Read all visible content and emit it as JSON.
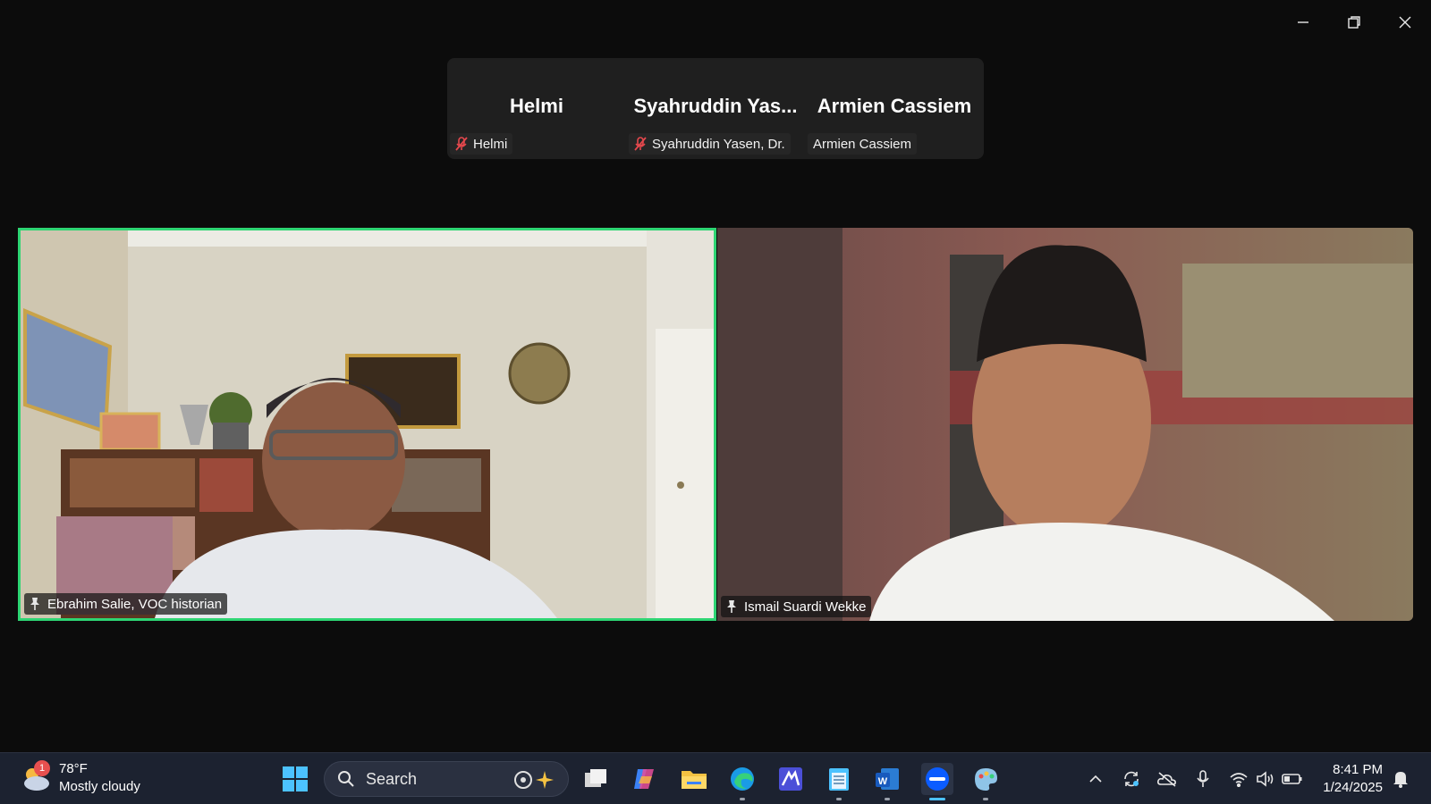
{
  "window": {
    "controls": [
      "minimize-icon",
      "restore-icon",
      "close-icon"
    ]
  },
  "participant_strip": [
    {
      "display_name": "Helmi",
      "label": "Helmi",
      "muted": true
    },
    {
      "display_name": "Syahruddin  Yas...",
      "label": "Syahruddin Yasen, Dr.",
      "muted": true
    },
    {
      "display_name": "Armien Cassiem",
      "label": "Armien Cassiem",
      "muted": false
    }
  ],
  "videos": [
    {
      "name": "Ebrahim Salie, VOC historian",
      "pinned": true,
      "active_speaker": true
    },
    {
      "name": "Ismail Suardi Wekke",
      "pinned": true,
      "active_speaker": false
    }
  ],
  "colors": {
    "active_speaker_border": "#2ed573",
    "muted_mic": "#e5484d",
    "taskbar": "#1c2230"
  },
  "taskbar": {
    "weather": {
      "badge": "1",
      "temperature": "78°F",
      "condition": "Mostly cloudy"
    },
    "search_label": "Search",
    "apps": [
      "windows-start-icon",
      "task-view-icon",
      "copilot-icon",
      "file-explorer-icon",
      "edge-icon",
      "visual-studio-icon",
      "notepad-icon",
      "word-icon",
      "zoom-icon",
      "paint-icon"
    ],
    "tray": [
      "chevron-up-icon",
      "sync-icon",
      "onedrive-icon",
      "microphone-icon",
      "wifi-icon",
      "volume-icon",
      "battery-icon"
    ],
    "time": "8:41 PM",
    "date": "1/24/2025"
  }
}
